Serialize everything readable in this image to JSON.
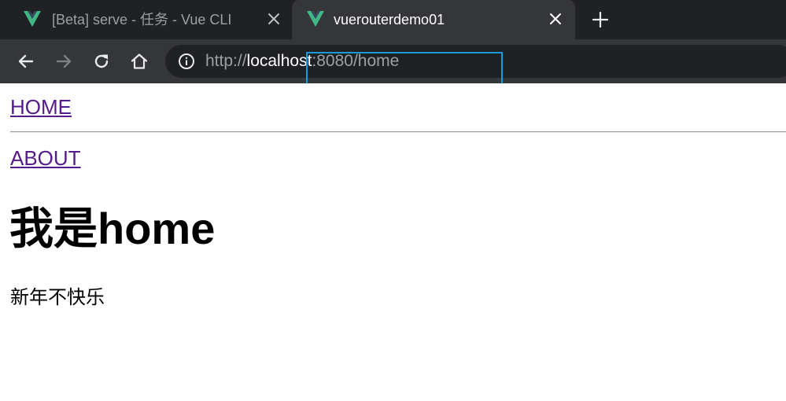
{
  "browser": {
    "tabs": [
      {
        "title": "[Beta] serve - 任务 - Vue CLI",
        "favicon": "vue-logo-icon",
        "active": false
      },
      {
        "title": "vuerouterdemo01",
        "favicon": "vue-logo-icon",
        "active": true
      }
    ],
    "url": {
      "scheme": "http://",
      "host": "localhost",
      "rest": ":8080/home"
    },
    "icons": {
      "back": "arrow-left-icon",
      "forward": "arrow-right-icon",
      "reload": "reload-icon",
      "home": "home-icon",
      "info": "info-icon",
      "close": "close-icon",
      "new_tab": "plus-icon"
    },
    "colors": {
      "tabstrip": "#202124",
      "toolbar": "#35363a",
      "vue_green": "#41b883",
      "focus_outline": "#1a9bd7"
    }
  },
  "page": {
    "links": {
      "home": "HOME",
      "about": "ABOUT"
    },
    "heading": "我是home",
    "paragraph": "新年不快乐",
    "colors": {
      "link": "#551a8b"
    }
  }
}
